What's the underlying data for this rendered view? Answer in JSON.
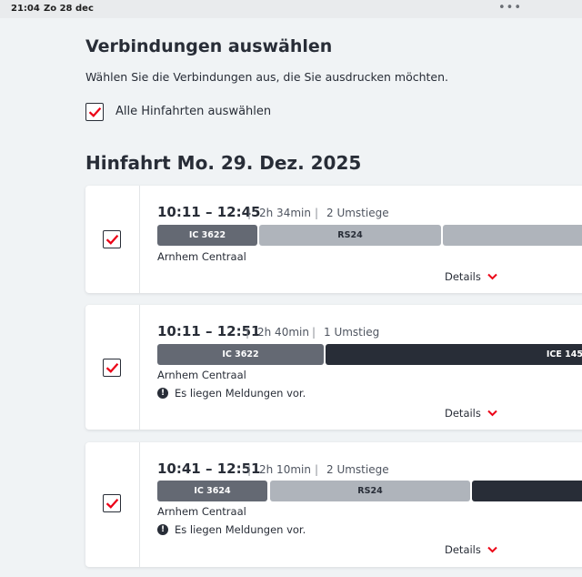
{
  "statusbar": {
    "time": "21:04",
    "date": "Zo 28 dec",
    "dots": "•••"
  },
  "page": {
    "title": "Verbindungen auswählen",
    "intro": "Wählen Sie die Verbindungen aus, die Sie ausdrucken möchten.",
    "select_all_label": "Alle Hinfahrten auswählen"
  },
  "section": {
    "label": "Hinfahrt",
    "date": "Mo. 29. Dez. 2025"
  },
  "connections": [
    {
      "times": "10:11 – 12:45",
      "duration": "2h 34min",
      "changes": "2 Umstiege",
      "trains": [
        "IC 3622",
        "RS24",
        ""
      ],
      "station": "Arnhem Centraal",
      "notice": "",
      "details": "Details",
      "checked": true
    },
    {
      "times": "10:11 – 12:51",
      "duration": "2h 40min",
      "changes": "1 Umstieg",
      "trains": [
        "IC 3622",
        "ICE 145"
      ],
      "station": "Arnhem Centraal",
      "notice": "Es liegen Meldungen vor.",
      "details": "Details",
      "checked": true
    },
    {
      "times": "10:41 – 12:51",
      "duration": "2h 10min",
      "changes": "2 Umstiege",
      "trains": [
        "IC 3624",
        "RS24",
        ""
      ],
      "station": "Arnhem Centraal",
      "notice": "Es liegen Meldungen vor.",
      "details": "Details",
      "checked": true
    }
  ],
  "colors": {
    "accent_red": "#ec0016",
    "ic_segment": "#646973",
    "rs_segment": "#afb4bb",
    "ice_segment": "#282d37",
    "background": "#f0f3f5"
  },
  "icons": {
    "check": "check-icon",
    "chevron": "chevron-down-icon",
    "info": "info-icon"
  }
}
